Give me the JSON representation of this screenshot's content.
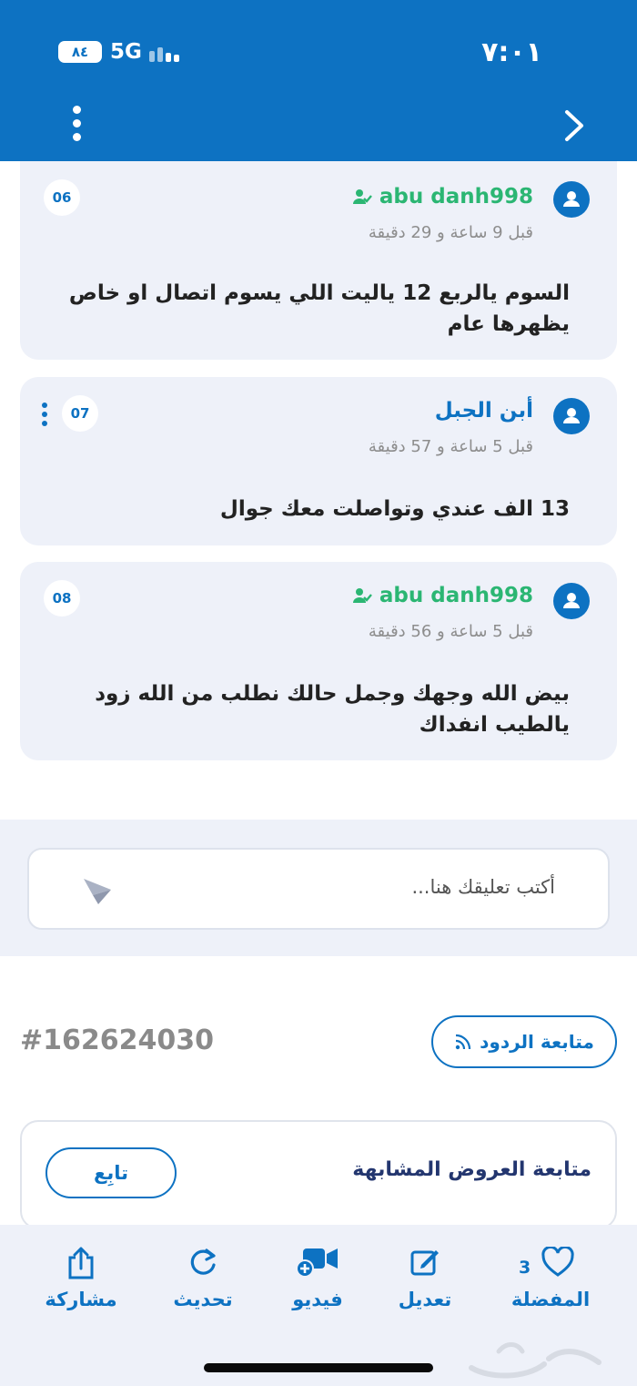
{
  "status_bar": {
    "time": "٧:٠١",
    "battery": "٨٤",
    "network": "5G"
  },
  "comments": [
    {
      "author": "abu danh998",
      "author_verified": true,
      "time": "قبل 9 ساعة و 29 دقيقة",
      "number": "06",
      "text": "السوم يالربع 12 ياليت اللي يسوم اتصال او خاص يظهرها عام",
      "has_menu": false
    },
    {
      "author": "أبن الجبل",
      "author_verified": false,
      "time": "قبل 5 ساعة و 57 دقيقة",
      "number": "07",
      "text": "13 الف عندي وتواصلت معك جوال",
      "has_menu": true
    },
    {
      "author": "abu danh998",
      "author_verified": true,
      "time": "قبل 5 ساعة و 56 دقيقة",
      "number": "08",
      "text": "بيض الله وجهك وجمل حالك نطلب من الله زود يالطيب  انفداك",
      "has_menu": false
    }
  ],
  "comment_input": {
    "placeholder": "أكتب تعليقك هنا..."
  },
  "ad": {
    "id": "#162624030",
    "follow_replies_label": "متابعة الردود"
  },
  "similar": {
    "label": "متابعة العروض المشابهة",
    "follow_label": "تابِع"
  },
  "bottom_nav": {
    "favorites": {
      "label": "المفضلة",
      "count": "3"
    },
    "edit": {
      "label": "تعديل"
    },
    "video": {
      "label": "فيديو"
    },
    "refresh": {
      "label": "تحديث"
    },
    "share": {
      "label": "مشاركة"
    }
  },
  "colors": {
    "primary": "#0d72c2",
    "verified_green": "#2bb673",
    "card_bg": "#eef1f9"
  }
}
